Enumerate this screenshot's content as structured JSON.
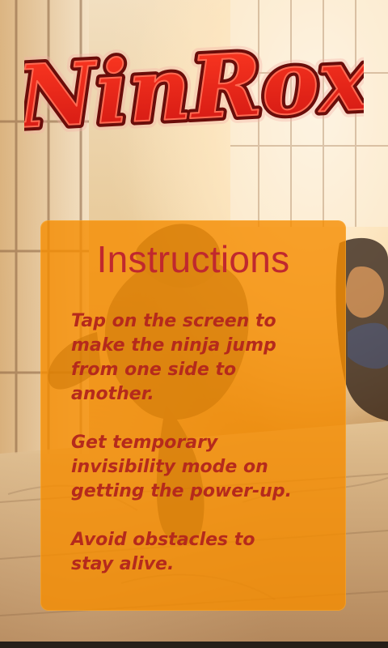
{
  "app": {
    "title": "NinRox"
  },
  "instructions": {
    "heading": "Instructions",
    "paragraphs": [
      "Tap on the screen to\nmake the ninja jump\nfrom one side to\nanother.",
      "Get temporary\ninvisibility mode on\ngetting the power-up.",
      "Avoid obstacles to\nstay alive."
    ]
  },
  "colors": {
    "panel": "#f58c00",
    "heading_text": "#c0282e",
    "body_text": "#b52a1c",
    "logo_red": "#d8221d",
    "logo_outline": "#6a0d0a"
  }
}
